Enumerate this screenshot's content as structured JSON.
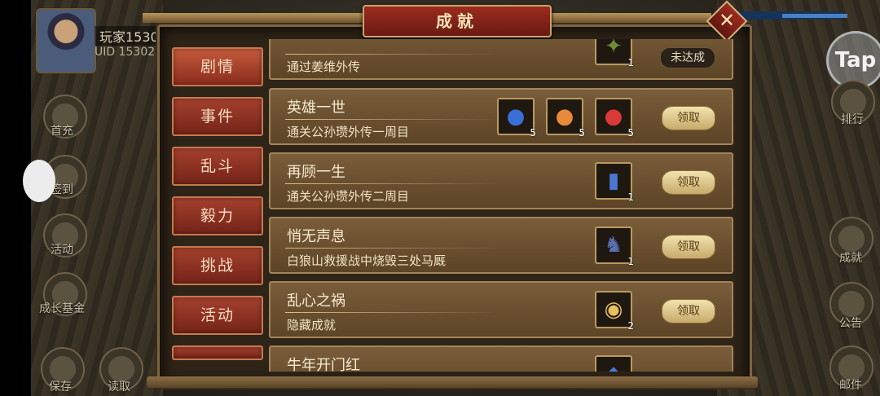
{
  "player": {
    "name": "玩家1530",
    "uid": "UID  15302"
  },
  "title": "成就",
  "tabs": [
    {
      "label": "剧情",
      "active": true
    },
    {
      "label": "事件",
      "active": false
    },
    {
      "label": "乱斗",
      "active": false
    },
    {
      "label": "毅力",
      "active": false
    },
    {
      "label": "挑战",
      "active": false
    },
    {
      "label": "活动",
      "active": false
    }
  ],
  "achievements": [
    {
      "name": "",
      "desc": "通过姜维外传",
      "status": "未达成",
      "items": [
        {
          "icon": "green-staff-icon",
          "count": "1",
          "color": "#6b8f3a"
        }
      ]
    },
    {
      "name": "英雄一世",
      "desc": "通关公孙瓒外传一周目",
      "status": "领取",
      "items": [
        {
          "icon": "blue-fruit-icon",
          "count": "5",
          "color": "#3a6fd8"
        },
        {
          "icon": "orange-fruit-icon",
          "count": "5",
          "color": "#e88a3a"
        },
        {
          "icon": "red-fruit-icon",
          "count": "5",
          "color": "#d83a3a"
        }
      ]
    },
    {
      "name": "再顾一生",
      "desc": "通关公孙瓒外传二周目",
      "status": "领取",
      "items": [
        {
          "icon": "blue-scroll-icon",
          "count": "1",
          "color": "#4a78d0"
        }
      ]
    },
    {
      "name": "悄无声息",
      "desc": "白狼山救援战中烧毁三处马厩",
      "status": "领取",
      "items": [
        {
          "icon": "armored-horse-icon",
          "count": "1",
          "color": "#5a6fb0"
        }
      ]
    },
    {
      "name": "乱心之祸",
      "desc": "隐藏成就",
      "status": "领取",
      "items": [
        {
          "icon": "gold-coin-icon",
          "count": "2",
          "color": "#e8c060"
        }
      ]
    },
    {
      "name": "牛年开门红",
      "desc": "",
      "status": "",
      "items": [
        {
          "icon": "blue-item-icon",
          "count": "",
          "color": "#4a78d0"
        }
      ]
    }
  ],
  "side_left": [
    {
      "label": "首充",
      "icon": "gift-icon"
    },
    {
      "label": "签到",
      "icon": "calendar-icon"
    },
    {
      "label": "活动",
      "icon": "lantern-icon"
    },
    {
      "label": "成长基金",
      "icon": "plant-icon"
    },
    {
      "label": "保存",
      "icon": "save-icon"
    },
    {
      "label": "读取",
      "icon": "load-icon"
    }
  ],
  "side_right": [
    {
      "label": "排行",
      "icon": "ranking-icon"
    },
    {
      "label": "成就",
      "icon": "trophy-icon"
    },
    {
      "label": "公告",
      "icon": "notice-icon"
    },
    {
      "label": "邮件",
      "icon": "mail-icon"
    }
  ],
  "tap_label": "Tap",
  "close_glyph": "✕"
}
